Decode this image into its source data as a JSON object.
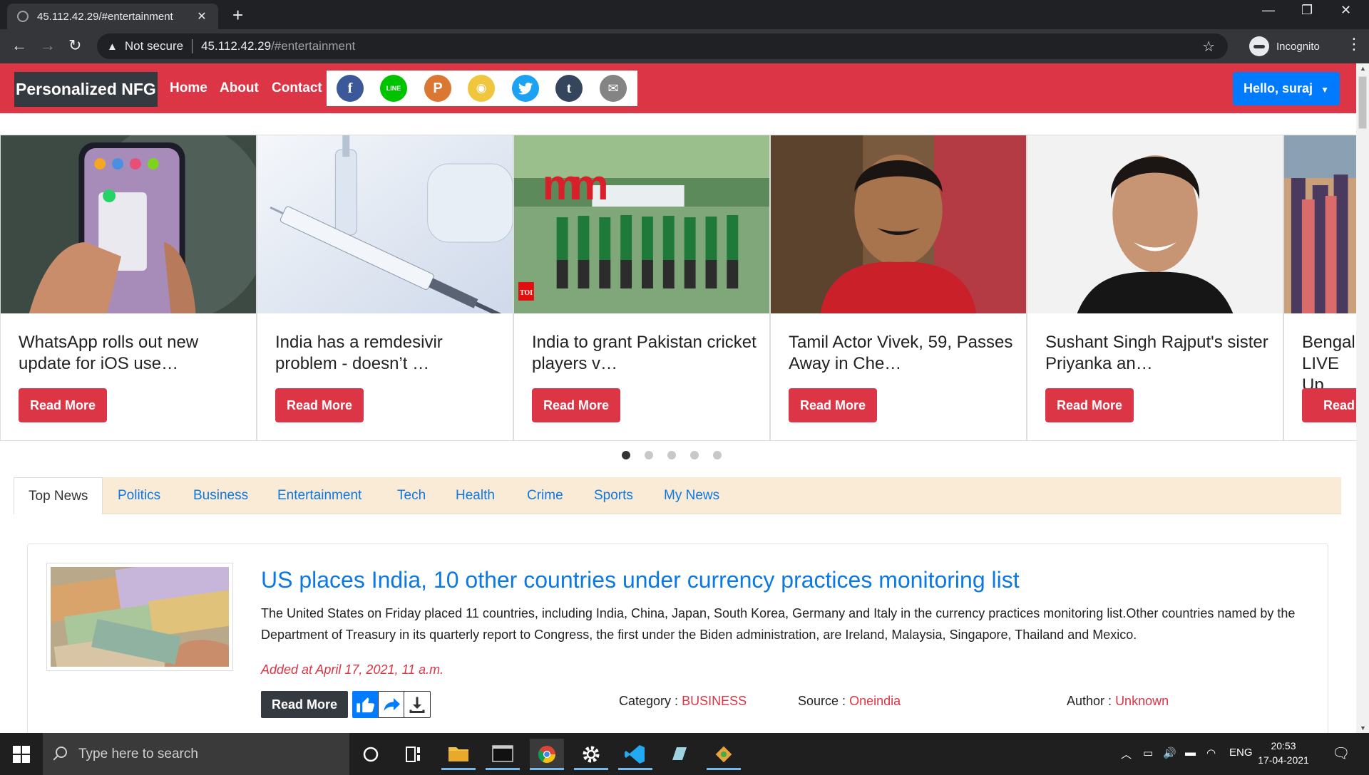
{
  "browser": {
    "tab_title": "45.112.42.29/#entertainment",
    "security_label": "Not secure",
    "url_host": "45.112.42.29",
    "url_path": "/#entertainment",
    "profile_label": "Incognito"
  },
  "site": {
    "brand": "Personalized NFG",
    "nav": [
      "Home",
      "About",
      "Contact"
    ],
    "share_icons": [
      "facebook-icon",
      "line-icon",
      "p-icon",
      "weibo-icon",
      "twitter-icon",
      "tumblr-icon",
      "email-icon"
    ],
    "user_menu": "Hello, suraj",
    "accent_color": "#dc3545"
  },
  "carousel": {
    "cards": [
      {
        "title": "WhatsApp rolls out new update for iOS use…",
        "button": "Read More"
      },
      {
        "title": "India has a remdesivir problem - doesn’t …",
        "button": "Read More"
      },
      {
        "title": "India to grant Pakistan cricket players v…",
        "button": "Read More"
      },
      {
        "title": "Tamil Actor Vivek, 59, Passes Away in Che…",
        "button": "Read More"
      },
      {
        "title": "Sushant Singh Rajput's sister Priyanka an…",
        "button": "Read More"
      },
      {
        "title": "Bengal LIVE Up",
        "button": "Read M"
      }
    ],
    "toi_badge": "TOI",
    "dot_count": 5,
    "active_dot": 0
  },
  "categories": {
    "tabs": [
      "Top News",
      "Politics",
      "Business",
      "Entertainment",
      "Tech",
      "Health",
      "Crime",
      "Sports",
      "My News"
    ],
    "active": "Top News"
  },
  "article": {
    "title": "US places India, 10 other countries under currency practices monitoring list",
    "summary": "The United States on Friday placed 11 countries, including India, China, Japan, South Korea, Germany and Italy in the currency practices monitoring list.Other countries named by the Department of Treasury in its quarterly report to Congress, the first under the Biden administration, are Ireland, Malaysia, Singapore, Thailand and Mexico.",
    "date": "Added at April 17, 2021, 11 a.m.",
    "read_more": "Read More",
    "category_label": "Category :",
    "category_value": "BUSINESS",
    "source_label": "Source :",
    "source_value": "Oneindia",
    "author_label": "Author :",
    "author_value": "Unknown"
  },
  "taskbar": {
    "search_placeholder": "Type here to search",
    "language": "ENG",
    "time": "20:53",
    "date": "17-04-2021"
  }
}
